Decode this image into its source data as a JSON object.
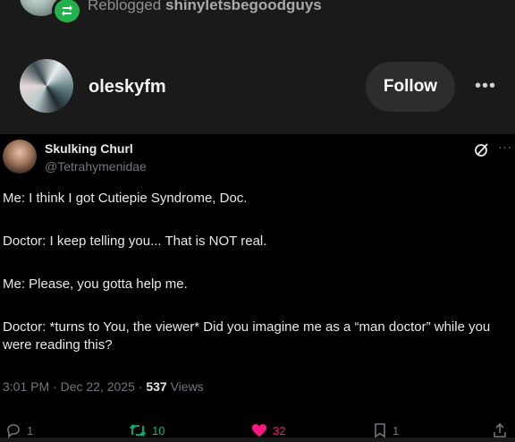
{
  "reblog": {
    "prefix": "Reblogged",
    "username": "shinyletsbegoodguys"
  },
  "post": {
    "author": "oleskyfm",
    "follow_label": "Follow",
    "more_label": "•••"
  },
  "tweet": {
    "display_name": "Skulking Churl",
    "handle": "@Tetrahymenidae",
    "more_label": "···",
    "body": [
      "Me: I think I got Cutiepie Syndrome, Doc.",
      "Doctor: I keep telling you... That is NOT real.",
      "Me: Please, you gotta help me.",
      "Doctor: *turns to You, the viewer* Did you imagine me as a “man doctor” while you were reading this?"
    ],
    "time": "3:01 PM",
    "date": "Dec 22, 2025",
    "separator": "·",
    "views_count": "537",
    "views_label": "Views",
    "actions": {
      "replies": "1",
      "retweets": "10",
      "likes": "32",
      "bookmarks": "1"
    }
  },
  "colors": {
    "reblog_badge": "#23b14d",
    "retweet": "#00ba7c",
    "like": "#f91880",
    "muted": "#71767b"
  }
}
